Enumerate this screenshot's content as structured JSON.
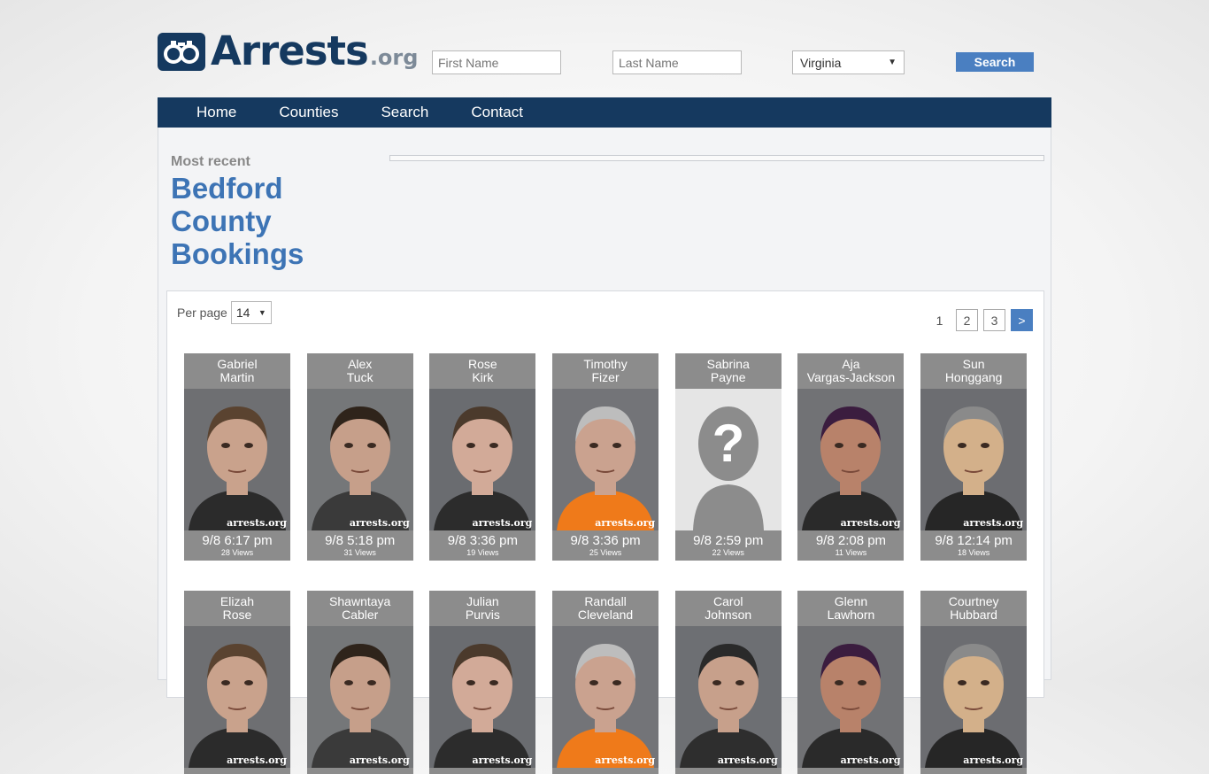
{
  "brand": {
    "name": "Arrests",
    "tld": ".org"
  },
  "header": {
    "first_name_placeholder": "First Name",
    "last_name_placeholder": "Last Name",
    "state": "Virginia",
    "search_label": "Search"
  },
  "nav": [
    "Home",
    "Counties",
    "Search",
    "Contact"
  ],
  "main": {
    "most_recent": "Most recent",
    "title": "Bedford County Bookings",
    "per_page_label": "Per page",
    "per_page_value": "14",
    "pages": [
      "1",
      "2",
      "3",
      ">"
    ]
  },
  "colors": {
    "navy": "#15395f",
    "accent": "#4a7fc1",
    "card": "#8c8c8c"
  },
  "watermark": "arrests.org",
  "bookings": [
    {
      "first": "Gabriel",
      "last": "Martin",
      "time": "9/8 6:17 pm",
      "views": "28 Views",
      "photo": true
    },
    {
      "first": "Alex",
      "last": "Tuck",
      "time": "9/8 5:18 pm",
      "views": "31 Views",
      "photo": true
    },
    {
      "first": "Rose",
      "last": "Kirk",
      "time": "9/8 3:36 pm",
      "views": "19 Views",
      "photo": true
    },
    {
      "first": "Timothy",
      "last": "Fizer",
      "time": "9/8 3:36 pm",
      "views": "25 Views",
      "photo": true
    },
    {
      "first": "Sabrina",
      "last": "Payne",
      "time": "9/8 2:59 pm",
      "views": "22 Views",
      "photo": false
    },
    {
      "first": "Aja",
      "last": "Vargas-Jackson",
      "time": "9/8 2:08 pm",
      "views": "11 Views",
      "photo": true
    },
    {
      "first": "Sun",
      "last": "Honggang",
      "time": "9/8 12:14 pm",
      "views": "18 Views",
      "photo": true
    },
    {
      "first": "Elizah",
      "last": "Rose",
      "time": "",
      "views": "",
      "photo": true
    },
    {
      "first": "Shawntaya",
      "last": "Cabler",
      "time": "",
      "views": "",
      "photo": true
    },
    {
      "first": "Julian",
      "last": "Purvis",
      "time": "",
      "views": "",
      "photo": true
    },
    {
      "first": "Randall",
      "last": "Cleveland",
      "time": "",
      "views": "",
      "photo": true
    },
    {
      "first": "Carol",
      "last": "Johnson",
      "time": "",
      "views": "",
      "photo": true
    },
    {
      "first": "Glenn",
      "last": "Lawhorn",
      "time": "",
      "views": "",
      "photo": true
    },
    {
      "first": "Courtney",
      "last": "Hubbard",
      "time": "",
      "views": "",
      "photo": true
    }
  ]
}
